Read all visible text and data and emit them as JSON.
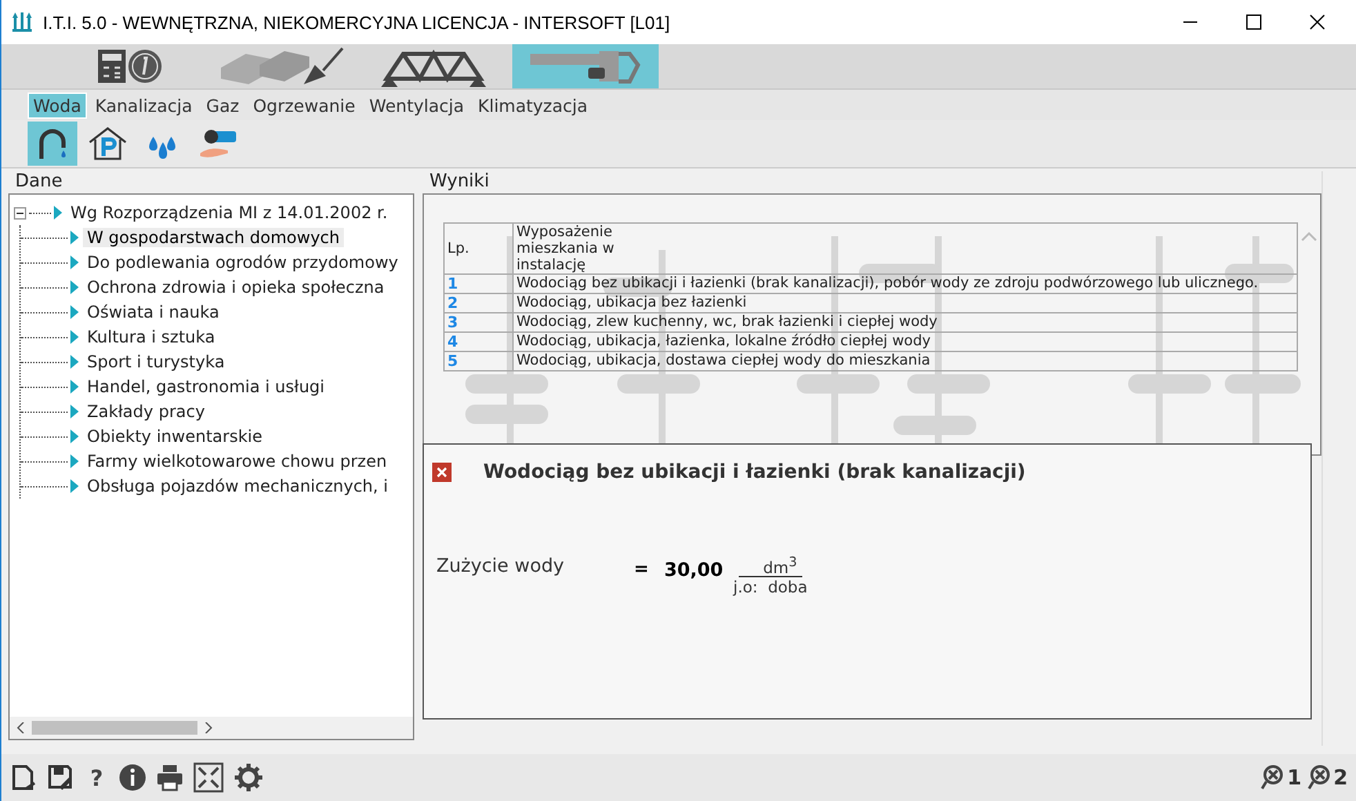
{
  "window": {
    "title": "I.T.I. 5.0 - WEWNĘTRZNA, NIEKOMERCYJNA LICENCJA - INTERSOFT [L01]"
  },
  "modules": [
    {
      "kind": "calc",
      "selected": false
    },
    {
      "kind": "bricks",
      "selected": false
    },
    {
      "kind": "truss",
      "selected": false
    },
    {
      "kind": "wrench",
      "selected": true
    }
  ],
  "menu": [
    {
      "label": "Woda",
      "selected": true
    },
    {
      "label": "Kanalizacja",
      "selected": false
    },
    {
      "label": "Gaz",
      "selected": false
    },
    {
      "label": "Ogrzewanie",
      "selected": false
    },
    {
      "label": "Wentylacja",
      "selected": false
    },
    {
      "label": "Klimatyzacja",
      "selected": false
    }
  ],
  "tools": [
    {
      "kind": "faucet",
      "selected": true
    },
    {
      "kind": "house",
      "selected": false
    },
    {
      "kind": "drops",
      "selected": false
    },
    {
      "kind": "hand",
      "selected": false
    }
  ],
  "data_panel": {
    "title": "Dane",
    "tree": {
      "label": "Wg Rozporządzenia  MI z 14.01.2002 r.",
      "expanded": true,
      "children": [
        {
          "label": "W gospodarstwach domowych",
          "selected": true
        },
        {
          "label": "Do podlewania ogrodów przydomowy",
          "selected": false
        },
        {
          "label": "Ochrona zdrowia i opieka społeczna",
          "selected": false
        },
        {
          "label": "Oświata i nauka",
          "selected": false
        },
        {
          "label": " Kultura i sztuka",
          "selected": false
        },
        {
          "label": "Sport i turystyka",
          "selected": false
        },
        {
          "label": "Handel, gastronomia i usługi",
          "selected": false
        },
        {
          "label": "Zakłady pracy",
          "selected": false
        },
        {
          "label": "Obiekty inwentarskie",
          "selected": false
        },
        {
          "label": "Farmy wielkotowarowe chowu przen",
          "selected": false
        },
        {
          "label": "Obsługa pojazdów mechanicznych, i",
          "selected": false
        }
      ]
    }
  },
  "results_panel": {
    "title": "Wyniki",
    "table": {
      "columns": [
        "Lp.",
        "Wyposażenie mieszkania w instalację"
      ],
      "rows": [
        [
          "1",
          "Wodociąg bez ubikacji i łazienki (brak kanalizacji), pobór wody ze zdroju podwórzowego lub ulicznego."
        ],
        [
          "2",
          "Wodociąg, ubikacja bez łazienki"
        ],
        [
          "3",
          "Wodociąg, zlew kuchenny, wc, brak łazienki i ciepłej wody"
        ],
        [
          "4",
          "Wodociąg, ubikacja, łazienka, lokalne źródło ciepłej wody"
        ],
        [
          "5",
          "Wodociąg, ubikacja, dostawa ciepłej wody do mieszkania"
        ]
      ]
    }
  },
  "detail": {
    "title": "Wodociąg bez ubikacji i łazienki (brak kanalizacji)",
    "label": "Zużycie wody",
    "equals": "=",
    "value": "30,00",
    "unit_top": "dm$^{3}$",
    "unit_bottom": "j.o:  doba"
  },
  "toolbar": [
    {
      "kind": "new"
    },
    {
      "kind": "save"
    },
    {
      "kind": "help",
      "text": "?"
    },
    {
      "kind": "info"
    },
    {
      "kind": "print"
    },
    {
      "kind": "fit"
    },
    {
      "kind": "settings"
    }
  ],
  "status": [
    {
      "text": "1"
    },
    {
      "text": "2"
    }
  ]
}
